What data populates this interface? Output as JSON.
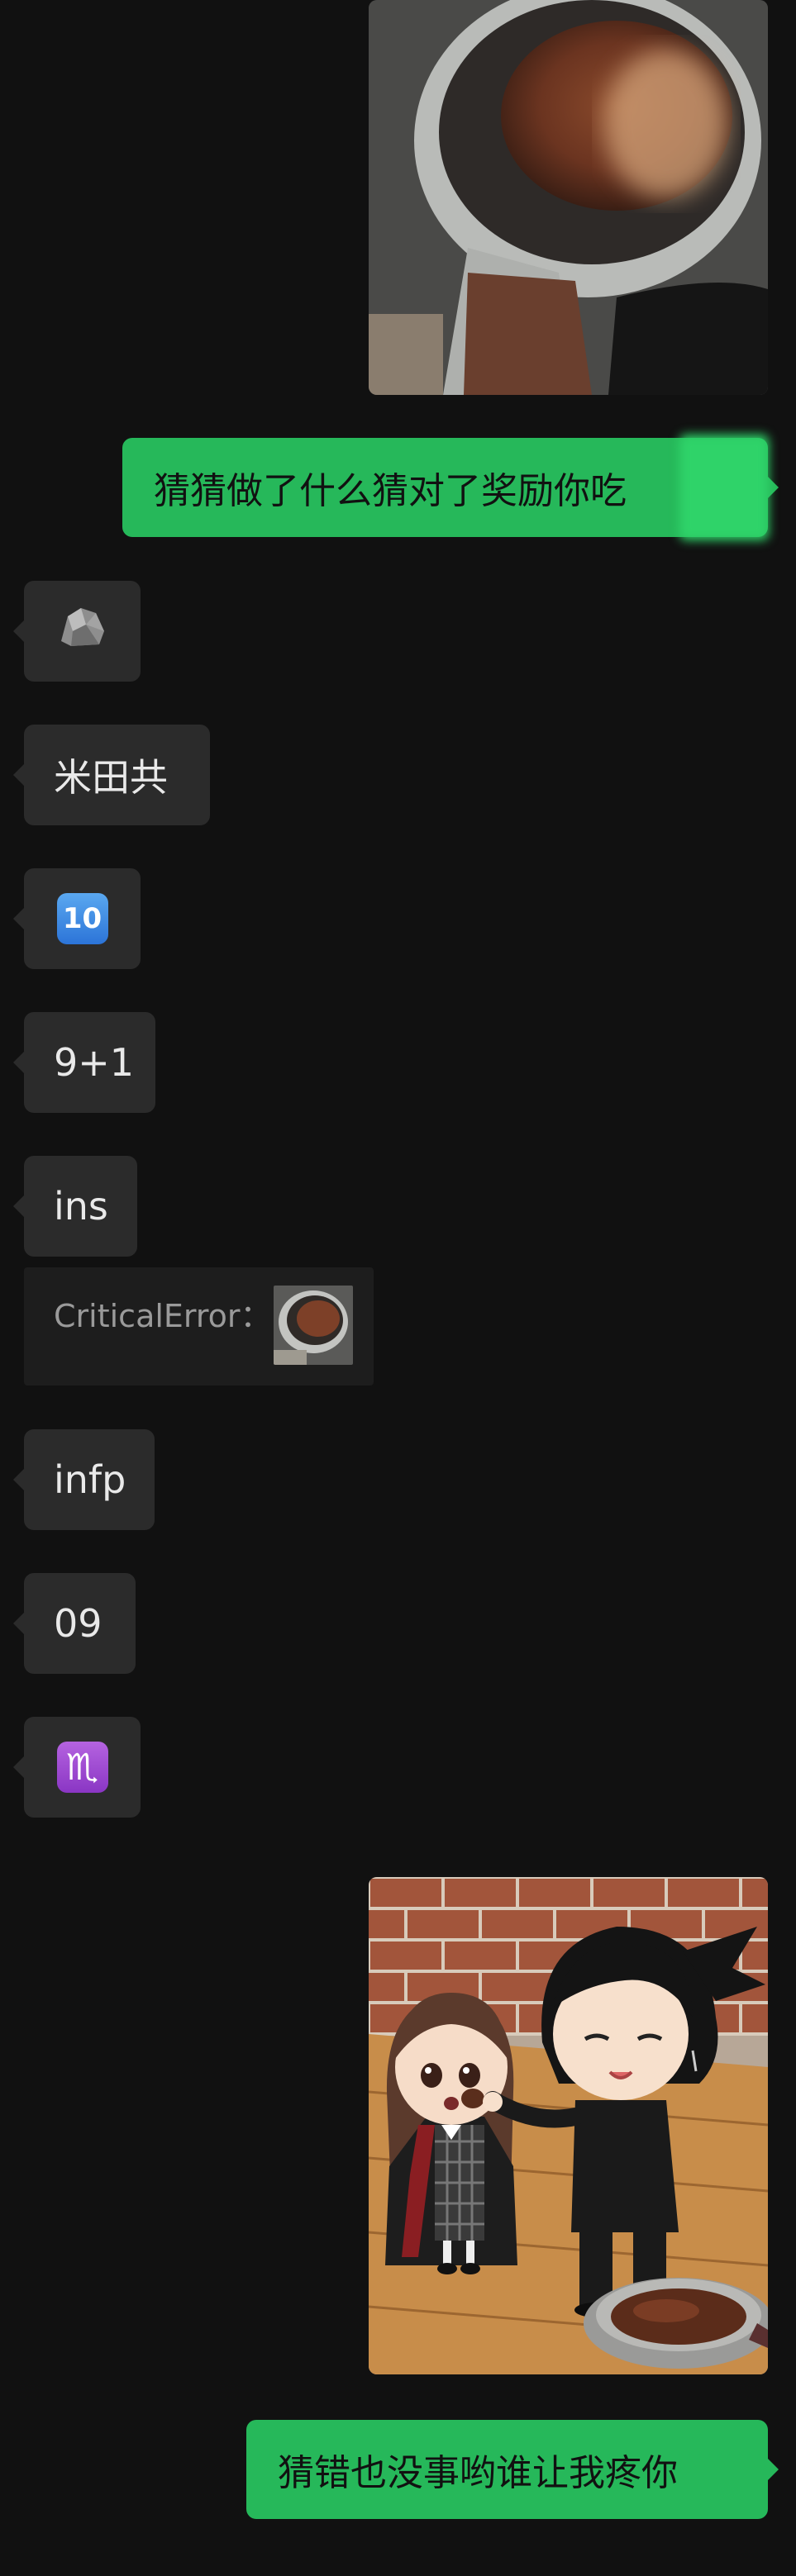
{
  "messages": {
    "out_text_1": "猜猜做了什么猜对了奖励你吃",
    "in_1_icon": "rock-icon",
    "in_2": "米田共",
    "in_3_icon": "keycap-ten-icon",
    "in_3_glyph": "10",
    "in_4": "9+1",
    "in_5": "ins",
    "quote_label": "CriticalError：",
    "in_6": "infp",
    "in_7": "09",
    "in_8_icon": "scorpio-sign-icon",
    "in_8_glyph": "♏",
    "out_text_2": "猜错也没事哟谁让我疼你"
  },
  "colors": {
    "background": "#111111",
    "out_bubble": "#26b85a",
    "in_bubble": "#2b2b2b",
    "in_text": "#e9e9e9",
    "quote_text": "#9a9a9a"
  }
}
